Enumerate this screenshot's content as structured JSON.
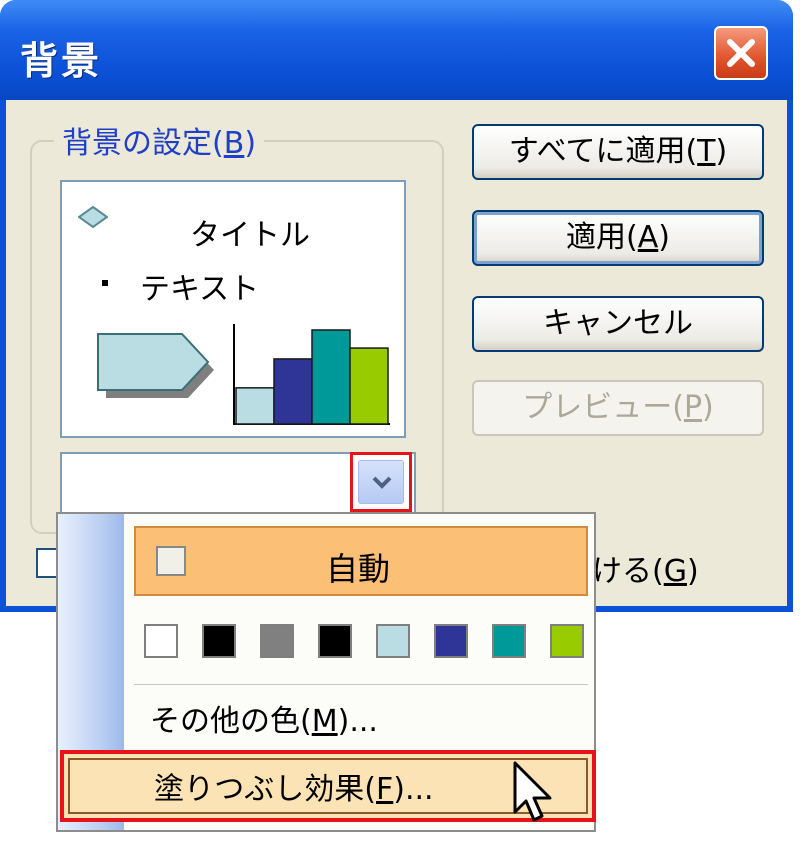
{
  "window": {
    "title": "背景"
  },
  "group": {
    "label": "背景の設定(",
    "label_key": "B",
    "label_end": ")",
    "preview": {
      "title": "タイトル",
      "text": "テキスト"
    }
  },
  "buttons": [
    {
      "label": "すべてに適用(",
      "key": "T",
      "end": ")",
      "state": "normal"
    },
    {
      "label": "適用(",
      "key": "A",
      "end": ")",
      "state": "default"
    },
    {
      "label": "キャンセル",
      "key": "",
      "end": "",
      "state": "normal"
    },
    {
      "label": "プレビュー(",
      "key": "P",
      "end": ")",
      "state": "disabled"
    }
  ],
  "checkbox": {
    "label_visible": "ける(",
    "key": "G",
    "end": ")"
  },
  "dropdown": {
    "auto_label": "自動",
    "swatch_colors": [
      "#ffffff",
      "#000000",
      "#808080",
      "#000000",
      "#b9dde3",
      "#2f3596",
      "#009999",
      "#99cc00"
    ],
    "more_colors": "その他の色(",
    "more_colors_key": "M",
    "more_colors_end": ")...",
    "fill_effects": "塗りつぶし効果(",
    "fill_effects_key": "F",
    "fill_effects_end": ")..."
  },
  "preview_chart": {
    "bar_colors": [
      "#b9dde3",
      "#2f3596",
      "#009999",
      "#99cc00"
    ],
    "bar_values": [
      20,
      36,
      52,
      42
    ]
  },
  "colors": {
    "titlebar": "#0a52d6",
    "highlight": "#fbbf75",
    "callout": "#e8121b"
  }
}
